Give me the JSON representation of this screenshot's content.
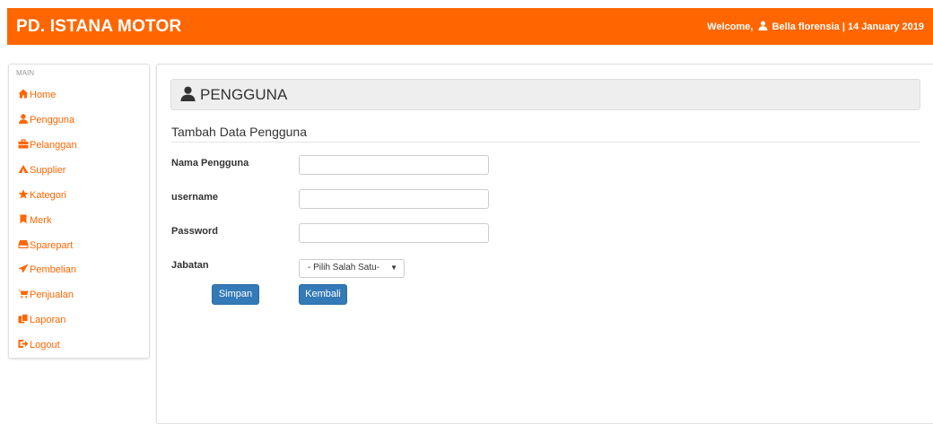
{
  "header": {
    "brand": "PD. ISTANA MOTOR",
    "welcome_prefix": "Welcome,",
    "user_name": "Bella florensia",
    "separator": "|",
    "date": "14 January 2019"
  },
  "sidebar": {
    "heading": "MAIN",
    "items": [
      {
        "label": "Home",
        "icon": "home-icon"
      },
      {
        "label": "Pengguna",
        "icon": "user-icon"
      },
      {
        "label": "Pelanggan",
        "icon": "briefcase-icon"
      },
      {
        "label": "Supplier",
        "icon": "tent-icon"
      },
      {
        "label": "Kategori",
        "icon": "star-icon"
      },
      {
        "label": "Merk",
        "icon": "bookmark-icon"
      },
      {
        "label": "Sparepart",
        "icon": "hdd-icon"
      },
      {
        "label": "Pembelian",
        "icon": "send-icon"
      },
      {
        "label": "Penjualan",
        "icon": "cart-icon"
      },
      {
        "label": "Laporan",
        "icon": "copy-icon"
      },
      {
        "label": "Logout",
        "icon": "logout-icon"
      }
    ]
  },
  "main": {
    "page_title": "PENGGUNA",
    "form_title": "Tambah Data Pengguna",
    "fields": {
      "nama": {
        "label": "Nama Pengguna",
        "value": ""
      },
      "username": {
        "label": "username",
        "value": ""
      },
      "password": {
        "label": "Password",
        "value": ""
      },
      "jabatan": {
        "label": "Jabatan",
        "selected": "- Pilih Salah Satu-"
      }
    },
    "buttons": {
      "save": "Simpan",
      "back": "Kembali"
    }
  },
  "colors": {
    "brand": "#ff6600",
    "primary_button": "#337ab7"
  }
}
